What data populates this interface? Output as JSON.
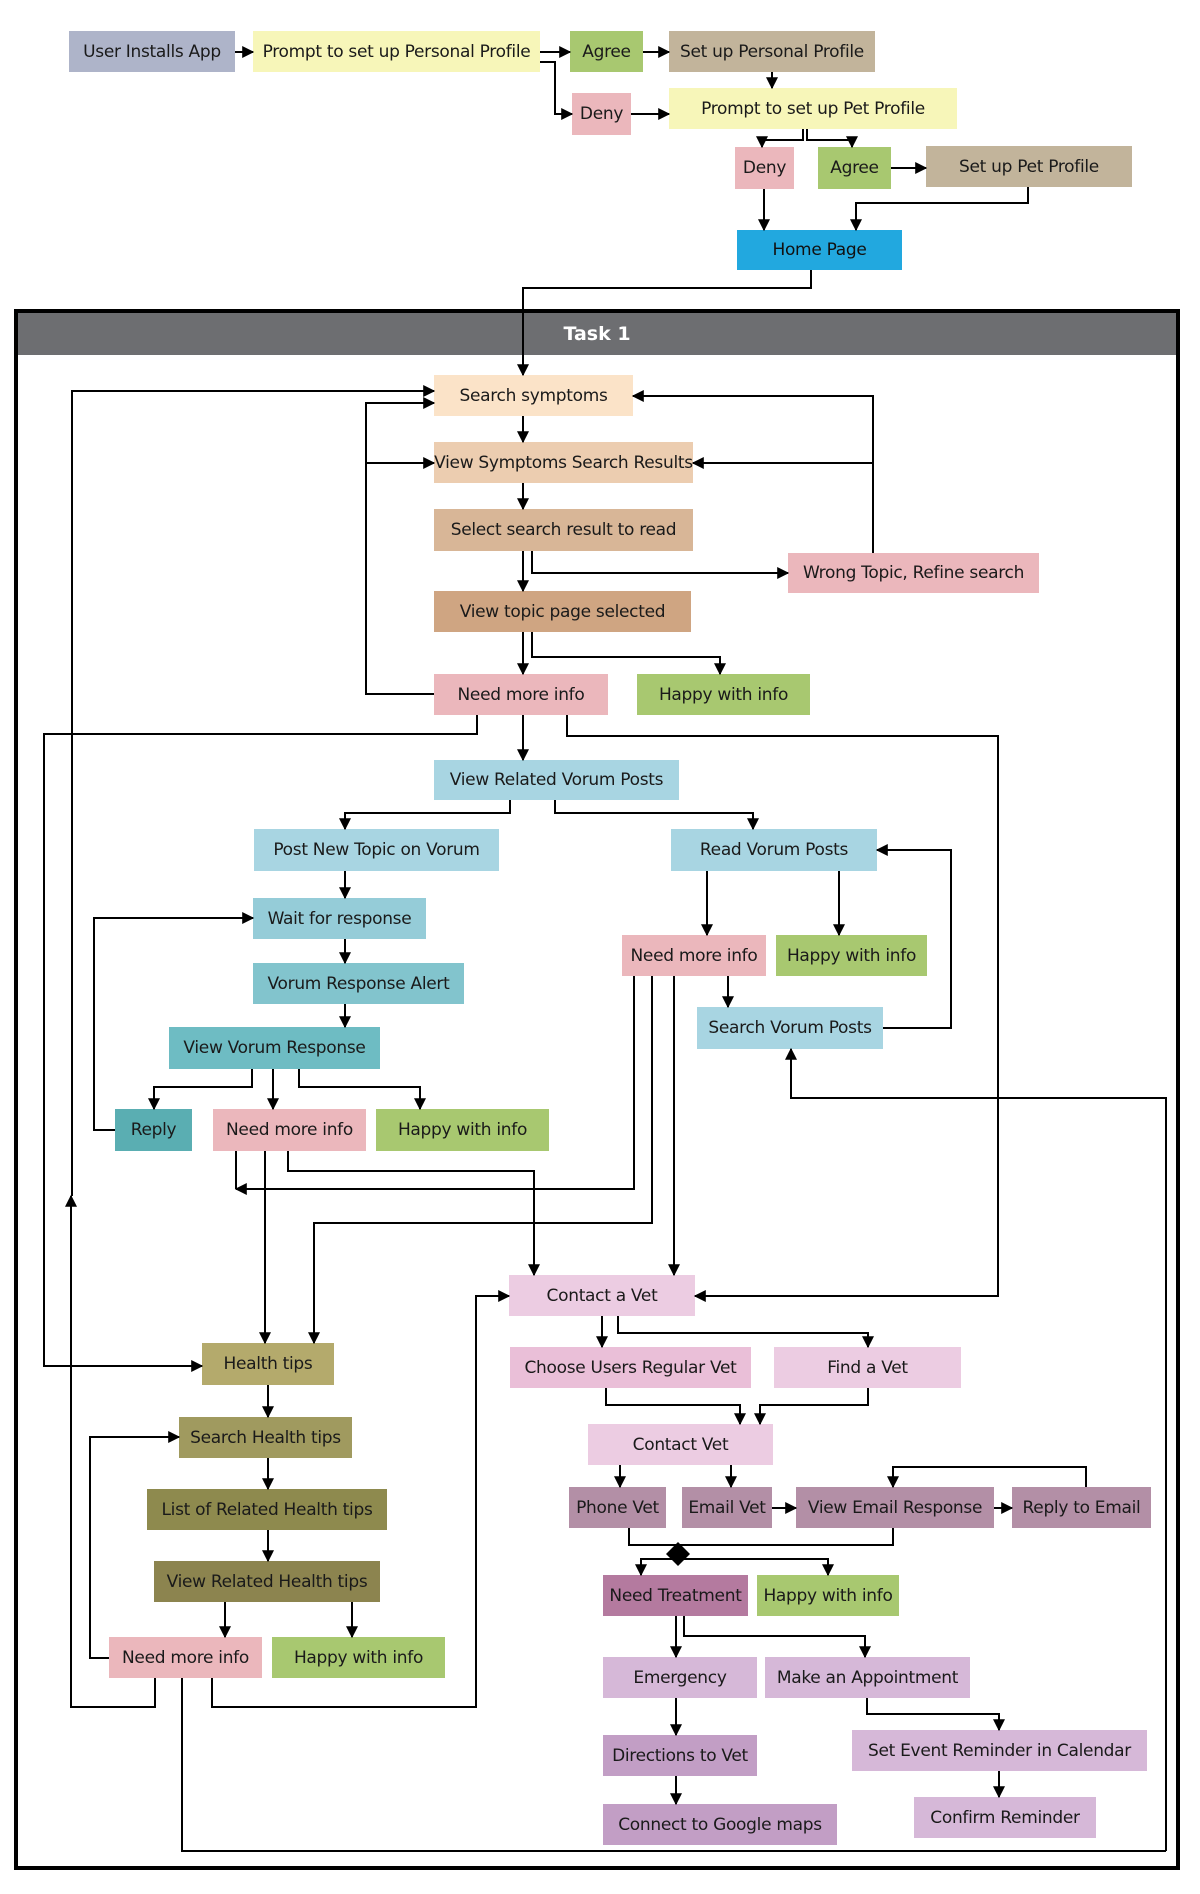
{
  "task": {
    "title": "Task 1"
  },
  "colors": {
    "lavender_gray": "#aeb4c9",
    "pale_yellow": "#f7f6b9",
    "green": "#a8c870",
    "pink": "#ebb7bc",
    "taupe": "#c2b49b",
    "blue_home": "#22a8df",
    "peach_1": "#fbe3c8",
    "peach_2": "#eccdb0",
    "tan_1": "#d8b697",
    "tan_2": "#cfa582",
    "light_blue": "#a8d5e2",
    "teal_1": "#95ccd8",
    "teal_2": "#82c4cd",
    "teal_3": "#6ebcc3",
    "teal_4": "#5aaeb2",
    "olive_1": "#b4aa6c",
    "olive_2": "#a09a5f",
    "olive_3": "#8e8a4e",
    "olive_4": "#8c844f",
    "lilac_1": "#eccce2",
    "lilac_2": "#eabfd8",
    "mauve": "#b38fa6",
    "plum": "#b47a9f",
    "orchid_1": "#d6b8d8",
    "orchid_2": "#c29ec5"
  },
  "nodes": {
    "user_installs_app": "User Installs App",
    "prompt_personal_profile": "Prompt to set up Personal Profile",
    "agree_personal": "Agree",
    "deny_personal": "Deny",
    "setup_personal_profile": "Set up Personal Profile",
    "prompt_pet_profile": "Prompt to set up Pet Profile",
    "deny_pet": "Deny",
    "agree_pet": "Agree",
    "setup_pet_profile": "Set up Pet Profile",
    "home_page": "Home Page",
    "search_symptoms": "Search symptoms",
    "view_symptoms_results": "View Symptoms Search Results",
    "select_search_result": "Select search result to read",
    "wrong_topic": "Wrong Topic, Refine search",
    "view_topic_page": "View topic page selected",
    "need_more_info_1": "Need more info",
    "happy_1": "Happy with info",
    "view_related_vorum": "View Related Vorum Posts",
    "post_new_topic": "Post New Topic on Vorum",
    "read_vorum_posts": "Read Vorum Posts",
    "wait_for_response": "Wait for response",
    "vorum_response_alert": "Vorum Response Alert",
    "view_vorum_response": "View Vorum Response",
    "reply": "Reply",
    "need_more_info_2": "Need more info",
    "happy_2": "Happy with info",
    "need_more_info_3": "Need more info",
    "happy_3": "Happy with info",
    "search_vorum_posts": "Search Vorum Posts",
    "contact_a_vet": "Contact a Vet",
    "choose_regular_vet": "Choose Users Regular Vet",
    "find_a_vet": "Find a Vet",
    "contact_vet": "Contact Vet",
    "phone_vet": "Phone Vet",
    "email_vet": "Email Vet",
    "view_email_response": "View Email Response",
    "reply_to_email": "Reply to  Email",
    "need_treatment": "Need Treatment",
    "happy_4": "Happy with info",
    "emergency": "Emergency",
    "make_appointment": "Make an Appointment",
    "directions_to_vet": "Directions to Vet",
    "connect_google_maps": "Connect to Google maps",
    "set_event_reminder": "Set Event Reminder in Calendar",
    "confirm_reminder": "Confirm Reminder",
    "health_tips": "Health tips",
    "search_health_tips": "Search Health tips",
    "list_related_health_tips": "List of  Related Health tips",
    "view_related_health_tips": "View Related Health tips",
    "need_more_info_4": "Need more info",
    "happy_5": "Happy with info"
  }
}
